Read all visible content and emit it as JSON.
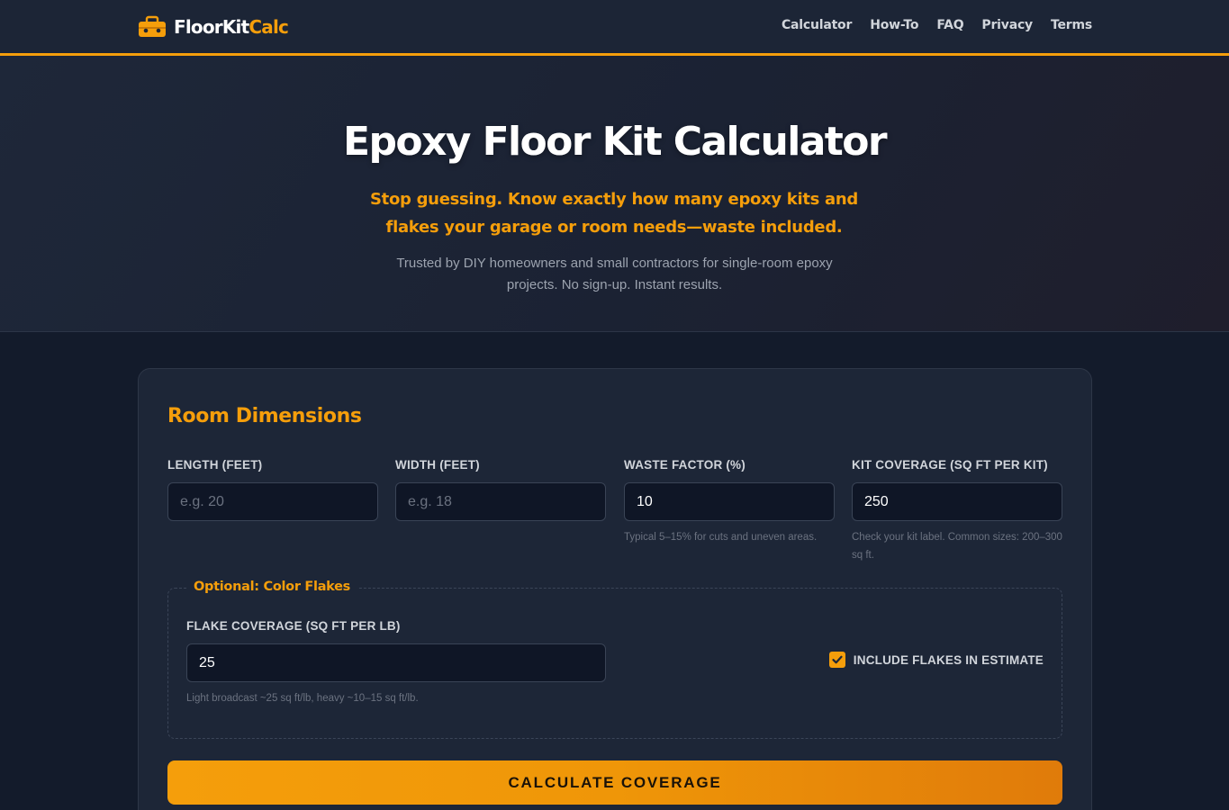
{
  "header": {
    "brand_main": "FloorKit",
    "brand_accent": "Calc",
    "nav": [
      "Calculator",
      "How-To",
      "FAQ",
      "Privacy",
      "Terms"
    ]
  },
  "hero": {
    "title": "Epoxy Floor Kit Calculator",
    "subtitle": "Stop guessing. Know exactly how many epoxy kits and flakes your garage or room needs—waste included.",
    "description": "Trusted by DIY homeowners and small contractors for single-room epoxy projects. No sign-up. Instant results."
  },
  "form": {
    "section_title": "Room Dimensions",
    "fields": [
      {
        "label": "LENGTH (FEET)",
        "value": "",
        "placeholder": "e.g. 20",
        "hint": ""
      },
      {
        "label": "WIDTH (FEET)",
        "value": "",
        "placeholder": "e.g. 18",
        "hint": ""
      },
      {
        "label": "WASTE FACTOR (%)",
        "value": "10",
        "placeholder": "",
        "hint": "Typical 5–15% for cuts and uneven areas."
      },
      {
        "label": "KIT COVERAGE (SQ FT PER KIT)",
        "value": "250",
        "placeholder": "",
        "hint": "Check your kit label. Common sizes: 200–300 sq ft."
      }
    ],
    "flakes": {
      "legend": "Optional: Color Flakes",
      "label": "FLAKE COVERAGE (SQ FT PER LB)",
      "value": "25",
      "hint": "Light broadcast ~25 sq ft/lb, heavy ~10–15 sq ft/lb.",
      "include_label": "INCLUDE FLAKES IN ESTIMATE",
      "include_checked": true
    },
    "submit_label": "CALCULATE COVERAGE"
  },
  "colors": {
    "accent": "#f59e0b",
    "background": "#131b2b",
    "card": "#1d2637",
    "header": "#1c2536"
  }
}
